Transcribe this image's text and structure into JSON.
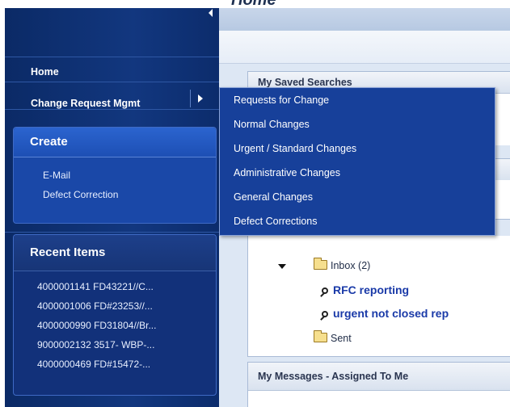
{
  "main": {
    "title": "Home",
    "saved_searches": {
      "title": "My Saved Searches"
    },
    "tree": {
      "inbox_label": "Inbox (2)",
      "searches": [
        "RFC reporting",
        "urgent not closed rep"
      ],
      "sent_label": "Sent"
    },
    "messages": {
      "title": "My Messages - Assigned To Me"
    }
  },
  "sidebar": {
    "nav": [
      {
        "label": "Home"
      },
      {
        "label": "Change Request Mgmt"
      }
    ],
    "create": {
      "title": "Create",
      "items": [
        "E-Mail",
        "Defect Correction"
      ]
    },
    "recent": {
      "title": "Recent Items",
      "items": [
        "4000001141 FD43221//C...",
        "4000001006 FD#23253//...",
        "4000000990 FD31804//Br...",
        "9000002132 3517- WBP-...",
        "4000000469 FD#15472-..."
      ]
    }
  },
  "dropdown": {
    "items": [
      "Requests for Change",
      "Normal Changes",
      "Urgent / Standard Changes",
      "Administrative Changes",
      "General Changes",
      "Defect Corrections"
    ]
  },
  "colors": {
    "sidebar_bg": "#12377f",
    "menu_bg": "#17409a",
    "link": "#1a3aa8",
    "main_bg": "#dde7f4"
  }
}
